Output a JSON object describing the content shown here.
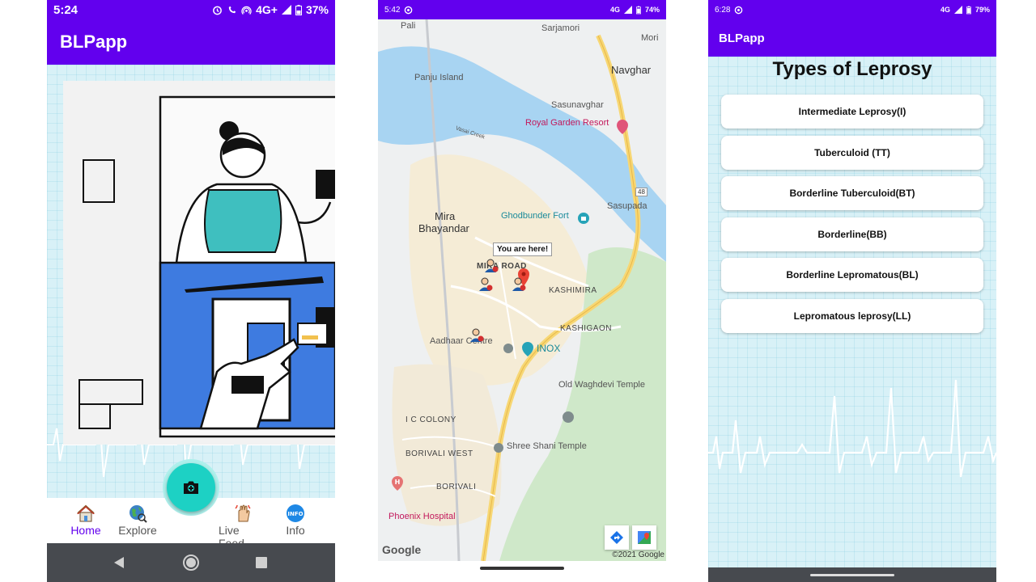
{
  "screen1": {
    "status": {
      "time": "5:24",
      "network": "4G+",
      "battery": "37%"
    },
    "app_title": "BLPapp",
    "nav": [
      {
        "label": "Home",
        "icon": "home-icon",
        "active": true
      },
      {
        "label": "Explore",
        "icon": "globe-icon",
        "active": false
      },
      {
        "label": "Live Feed",
        "icon": "live-feed-icon",
        "active": false
      },
      {
        "label": "Info",
        "icon": "info-icon",
        "active": false
      }
    ],
    "fab_icon": "camera-icon"
  },
  "screen2": {
    "status": {
      "time": "5:42",
      "network": "4G",
      "battery": "74%"
    },
    "tooltip": "You are here!",
    "labels": {
      "pali": "Pali",
      "sarjamori": "Sarjamori",
      "mori": "Mori",
      "navghar": "Navghar",
      "panju_island": "Panju Island",
      "sasunavghar": "Sasunavghar",
      "royal_garden": "Royal Garden Resort",
      "vasai_creek": "Vasai Creek",
      "sasupada": "Sasupada",
      "route": "48",
      "mira": "Mira",
      "bhayandar": "Bhayandar",
      "ghodbunder": "Ghodbunder Fort",
      "mira_road": "MIRA ROAD",
      "kashimira": "KASHIMIRA",
      "kashigaon": "KASHIGAON",
      "aadhaar": "Aadhaar Centre",
      "inox": "INOX",
      "old_waghdevi": "Old Waghdevi Temple",
      "ic_colony": "I C COLONY",
      "shree_shani": "Shree Shani Temple",
      "borivali_west": "BORIVALI WEST",
      "borivali": "BORIVALI",
      "phoenix": "Phoenix Hospital",
      "google": "Google",
      "copyright": "©2021 Google"
    }
  },
  "screen3": {
    "status": {
      "time": "6:28",
      "network": "4G",
      "battery": "79%"
    },
    "app_title": "BLPapp",
    "page_title": "Types of Leprosy",
    "types": [
      "Intermediate Leprosy(I)",
      "Tuberculoid (TT)",
      "Borderline Tuberculoid(BT)",
      "Borderline(BB)",
      "Borderline Lepromatous(BL)",
      "Lepromatous leprosy(LL)"
    ]
  },
  "colors": {
    "primary": "#6200ee",
    "accent": "#1dd1c4",
    "nav_dark": "#474a4f",
    "water": "#a8d4f2",
    "road": "#f7d774"
  }
}
